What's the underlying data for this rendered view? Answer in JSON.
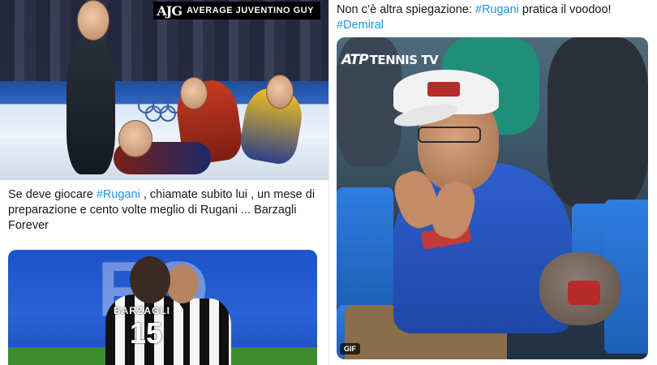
{
  "left_top_image": {
    "watermark_logo": "AJG",
    "watermark_text": "AVERAGE JUVENTINO GUY"
  },
  "tweet1": {
    "text_before": "Se deve giocare ",
    "hashtag": "#Rugani",
    "text_after": " , chiamate subito lui , un mese di preparazione e cento volte meglio di Rugani ... Barzagli Forever"
  },
  "left_bottom_image": {
    "background_letters": "FO",
    "jersey_name": "BARZAGLI",
    "jersey_number": "15"
  },
  "tweet2": {
    "text_before": "Non c’è altra spiegazione: ",
    "hashtag1": "#Rugani",
    "text_middle": " pratica il voodoo!",
    "hashtag2": "#Demiral"
  },
  "right_image": {
    "logo_atp": "ATP",
    "logo_tennistv": "TENNIS TV",
    "gif_badge": "GIF"
  },
  "colors": {
    "hashtag": "#1b95e0",
    "text": "#14171a"
  }
}
